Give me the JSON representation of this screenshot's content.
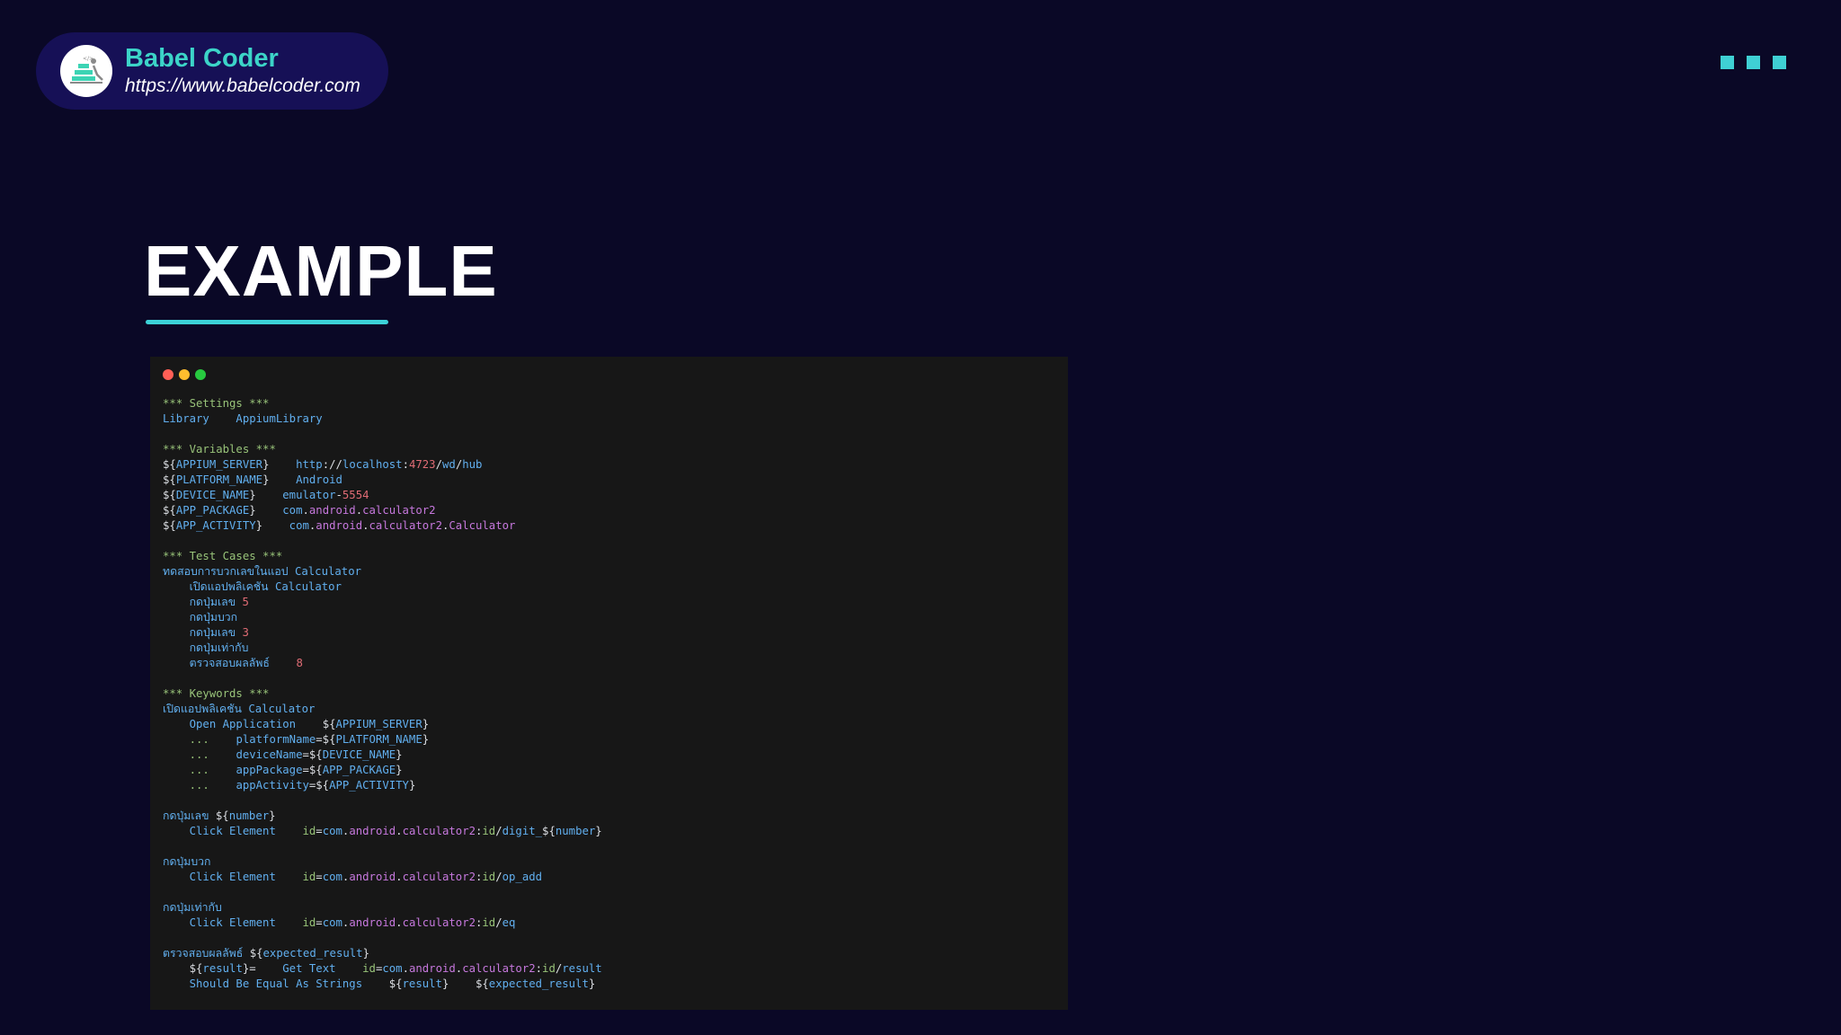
{
  "brand": {
    "name": "Babel Coder",
    "url": "https://www.babelcoder.com"
  },
  "slide": {
    "title": "EXAMPLE"
  },
  "colors": {
    "background": "#0a0826",
    "brand_pill": "#161056",
    "accent": "#3cd4c8",
    "code_bg": "#171717",
    "syntax_blue": "#61afef",
    "syntax_green": "#98c379",
    "syntax_red": "#e06c75",
    "syntax_purple": "#c678dd",
    "syntax_white": "#dcdfe4"
  },
  "code_lines": [
    [
      {
        "t": "*** Settings ***",
        "c": "g"
      }
    ],
    [
      {
        "t": "Library    AppiumLibrary",
        "c": "b"
      }
    ],
    [],
    [
      {
        "t": "*** Variables ***",
        "c": "g"
      }
    ],
    [
      {
        "t": "${",
        "c": "w"
      },
      {
        "t": "APPIUM_SERVER",
        "c": "b"
      },
      {
        "t": "}",
        "c": "w"
      },
      {
        "t": "    http",
        "c": "b"
      },
      {
        "t": "://",
        "c": "w"
      },
      {
        "t": "localhost",
        "c": "b"
      },
      {
        "t": ":",
        "c": "w"
      },
      {
        "t": "4723",
        "c": "r"
      },
      {
        "t": "/",
        "c": "w"
      },
      {
        "t": "wd",
        "c": "b"
      },
      {
        "t": "/",
        "c": "w"
      },
      {
        "t": "hub",
        "c": "b"
      }
    ],
    [
      {
        "t": "${",
        "c": "w"
      },
      {
        "t": "PLATFORM_NAME",
        "c": "b"
      },
      {
        "t": "}",
        "c": "w"
      },
      {
        "t": "    Android",
        "c": "b"
      }
    ],
    [
      {
        "t": "${",
        "c": "w"
      },
      {
        "t": "DEVICE_NAME",
        "c": "b"
      },
      {
        "t": "}",
        "c": "w"
      },
      {
        "t": "    emulator",
        "c": "b"
      },
      {
        "t": "-",
        "c": "w"
      },
      {
        "t": "5554",
        "c": "r"
      }
    ],
    [
      {
        "t": "${",
        "c": "w"
      },
      {
        "t": "APP_PACKAGE",
        "c": "b"
      },
      {
        "t": "}",
        "c": "w"
      },
      {
        "t": "    com",
        "c": "b"
      },
      {
        "t": ".",
        "c": "w"
      },
      {
        "t": "android",
        "c": "p"
      },
      {
        "t": ".",
        "c": "w"
      },
      {
        "t": "calculator2",
        "c": "p"
      }
    ],
    [
      {
        "t": "${",
        "c": "w"
      },
      {
        "t": "APP_ACTIVITY",
        "c": "b"
      },
      {
        "t": "}",
        "c": "w"
      },
      {
        "t": "    com",
        "c": "b"
      },
      {
        "t": ".",
        "c": "w"
      },
      {
        "t": "android",
        "c": "p"
      },
      {
        "t": ".",
        "c": "w"
      },
      {
        "t": "calculator2",
        "c": "p"
      },
      {
        "t": ".",
        "c": "w"
      },
      {
        "t": "Calculator",
        "c": "p"
      }
    ],
    [],
    [
      {
        "t": "*** Test Cases ***",
        "c": "g"
      }
    ],
    [
      {
        "t": "ทดสอบการบวกเลขในแอป Calculator",
        "c": "b"
      }
    ],
    [
      {
        "t": "    เปิดแอปพลิเคชัน Calculator",
        "c": "b"
      }
    ],
    [
      {
        "t": "    กดปุ่มเลข ",
        "c": "b"
      },
      {
        "t": "5",
        "c": "r"
      }
    ],
    [
      {
        "t": "    กดปุ่มบวก",
        "c": "b"
      }
    ],
    [
      {
        "t": "    กดปุ่มเลข ",
        "c": "b"
      },
      {
        "t": "3",
        "c": "r"
      }
    ],
    [
      {
        "t": "    กดปุ่มเท่ากับ",
        "c": "b"
      }
    ],
    [
      {
        "t": "    ตรวจสอบผลลัพธ์    ",
        "c": "b"
      },
      {
        "t": "8",
        "c": "r"
      }
    ],
    [],
    [
      {
        "t": "*** Keywords ***",
        "c": "g"
      }
    ],
    [
      {
        "t": "เปิดแอปพลิเคชัน Calculator",
        "c": "b"
      }
    ],
    [
      {
        "t": "    Open Application    ",
        "c": "b"
      },
      {
        "t": "${",
        "c": "w"
      },
      {
        "t": "APPIUM_SERVER",
        "c": "b"
      },
      {
        "t": "}",
        "c": "w"
      }
    ],
    [
      {
        "t": "    ...    ",
        "c": "g"
      },
      {
        "t": "platformName",
        "c": "b"
      },
      {
        "t": "=${",
        "c": "w"
      },
      {
        "t": "PLATFORM_NAME",
        "c": "b"
      },
      {
        "t": "}",
        "c": "w"
      }
    ],
    [
      {
        "t": "    ...    ",
        "c": "g"
      },
      {
        "t": "deviceName",
        "c": "b"
      },
      {
        "t": "=${",
        "c": "w"
      },
      {
        "t": "DEVICE_NAME",
        "c": "b"
      },
      {
        "t": "}",
        "c": "w"
      }
    ],
    [
      {
        "t": "    ...    ",
        "c": "g"
      },
      {
        "t": "appPackage",
        "c": "b"
      },
      {
        "t": "=${",
        "c": "w"
      },
      {
        "t": "APP_PACKAGE",
        "c": "b"
      },
      {
        "t": "}",
        "c": "w"
      }
    ],
    [
      {
        "t": "    ...    ",
        "c": "g"
      },
      {
        "t": "appActivity",
        "c": "b"
      },
      {
        "t": "=${",
        "c": "w"
      },
      {
        "t": "APP_ACTIVITY",
        "c": "b"
      },
      {
        "t": "}",
        "c": "w"
      }
    ],
    [],
    [
      {
        "t": "กดปุ่มเลข ",
        "c": "b"
      },
      {
        "t": "${",
        "c": "w"
      },
      {
        "t": "number",
        "c": "b"
      },
      {
        "t": "}",
        "c": "w"
      }
    ],
    [
      {
        "t": "    Click Element    ",
        "c": "b"
      },
      {
        "t": "id",
        "c": "g"
      },
      {
        "t": "=",
        "c": "w"
      },
      {
        "t": "com",
        "c": "b"
      },
      {
        "t": ".",
        "c": "w"
      },
      {
        "t": "android",
        "c": "p"
      },
      {
        "t": ".",
        "c": "w"
      },
      {
        "t": "calculator2",
        "c": "p"
      },
      {
        "t": ":",
        "c": "w"
      },
      {
        "t": "id",
        "c": "g"
      },
      {
        "t": "/",
        "c": "w"
      },
      {
        "t": "digit_",
        "c": "b"
      },
      {
        "t": "${",
        "c": "w"
      },
      {
        "t": "number",
        "c": "b"
      },
      {
        "t": "}",
        "c": "w"
      }
    ],
    [],
    [
      {
        "t": "กดปุ่มบวก",
        "c": "b"
      }
    ],
    [
      {
        "t": "    Click Element    ",
        "c": "b"
      },
      {
        "t": "id",
        "c": "g"
      },
      {
        "t": "=",
        "c": "w"
      },
      {
        "t": "com",
        "c": "b"
      },
      {
        "t": ".",
        "c": "w"
      },
      {
        "t": "android",
        "c": "p"
      },
      {
        "t": ".",
        "c": "w"
      },
      {
        "t": "calculator2",
        "c": "p"
      },
      {
        "t": ":",
        "c": "w"
      },
      {
        "t": "id",
        "c": "g"
      },
      {
        "t": "/",
        "c": "w"
      },
      {
        "t": "op_add",
        "c": "b"
      }
    ],
    [],
    [
      {
        "t": "กดปุ่มเท่ากับ",
        "c": "b"
      }
    ],
    [
      {
        "t": "    Click Element    ",
        "c": "b"
      },
      {
        "t": "id",
        "c": "g"
      },
      {
        "t": "=",
        "c": "w"
      },
      {
        "t": "com",
        "c": "b"
      },
      {
        "t": ".",
        "c": "w"
      },
      {
        "t": "android",
        "c": "p"
      },
      {
        "t": ".",
        "c": "w"
      },
      {
        "t": "calculator2",
        "c": "p"
      },
      {
        "t": ":",
        "c": "w"
      },
      {
        "t": "id",
        "c": "g"
      },
      {
        "t": "/",
        "c": "w"
      },
      {
        "t": "eq",
        "c": "b"
      }
    ],
    [],
    [
      {
        "t": "ตรวจสอบผลลัพธ์ ",
        "c": "b"
      },
      {
        "t": "${",
        "c": "w"
      },
      {
        "t": "expected_result",
        "c": "b"
      },
      {
        "t": "}",
        "c": "w"
      }
    ],
    [
      {
        "t": "    ${",
        "c": "w"
      },
      {
        "t": "result",
        "c": "b"
      },
      {
        "t": "}=",
        "c": "w"
      },
      {
        "t": "    Get Text    ",
        "c": "b"
      },
      {
        "t": "id",
        "c": "g"
      },
      {
        "t": "=",
        "c": "w"
      },
      {
        "t": "com",
        "c": "b"
      },
      {
        "t": ".",
        "c": "w"
      },
      {
        "t": "android",
        "c": "p"
      },
      {
        "t": ".",
        "c": "w"
      },
      {
        "t": "calculator2",
        "c": "p"
      },
      {
        "t": ":",
        "c": "w"
      },
      {
        "t": "id",
        "c": "g"
      },
      {
        "t": "/",
        "c": "w"
      },
      {
        "t": "result",
        "c": "b"
      }
    ],
    [
      {
        "t": "    Should Be Equal As Strings    ",
        "c": "b"
      },
      {
        "t": "${",
        "c": "w"
      },
      {
        "t": "result",
        "c": "b"
      },
      {
        "t": "}",
        "c": "w"
      },
      {
        "t": "    ",
        "c": "b"
      },
      {
        "t": "${",
        "c": "w"
      },
      {
        "t": "expected_result",
        "c": "b"
      },
      {
        "t": "}",
        "c": "w"
      }
    ]
  ]
}
